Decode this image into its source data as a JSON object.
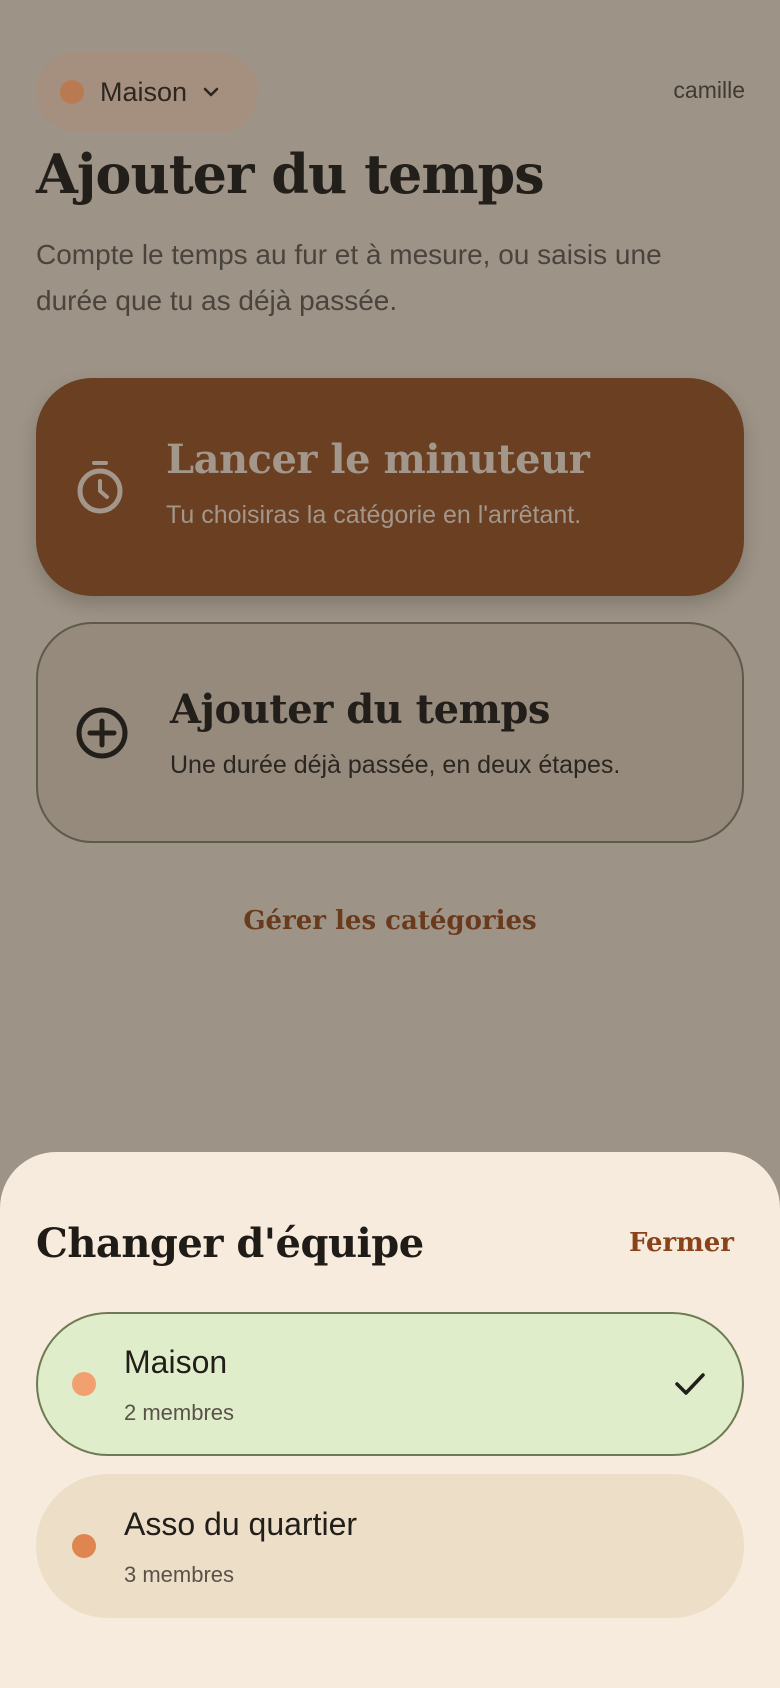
{
  "header": {
    "team_selector": {
      "name": "Maison",
      "dot_color": "#b97a52",
      "icon": "chevron-down-icon"
    },
    "username": "camille"
  },
  "main": {
    "title": "Ajouter du temps",
    "subtitle": "Compte le temps au fur et à mesure, ou saisis une durée que tu as déjà passée.",
    "timer_card": {
      "icon": "stopwatch-icon",
      "title": "Lancer le minuteur",
      "description": "Tu choisiras la catégorie en l'arrêtant."
    },
    "add_card": {
      "icon": "plus-circle-icon",
      "title": "Ajouter du temps",
      "description": "Une durée déjà passée, en deux étapes."
    },
    "manage_categories": "Gérer les catégories"
  },
  "sheet": {
    "title": "Changer d'équipe",
    "close_label": "Fermer",
    "teams": [
      {
        "name": "Maison",
        "members": "2 membres",
        "dot_color": "#f2a070",
        "selected": true,
        "icon": "check-icon"
      },
      {
        "name": "Asso du quartier",
        "members": "3 membres",
        "dot_color": "#de8550",
        "selected": false
      }
    ]
  },
  "colors": {
    "accent": "#6a3f22",
    "link": "#8a4218",
    "overlay": "#9d9386",
    "sheet_bg": "#f6ebdc",
    "selected_bg": "#e0edcb"
  }
}
